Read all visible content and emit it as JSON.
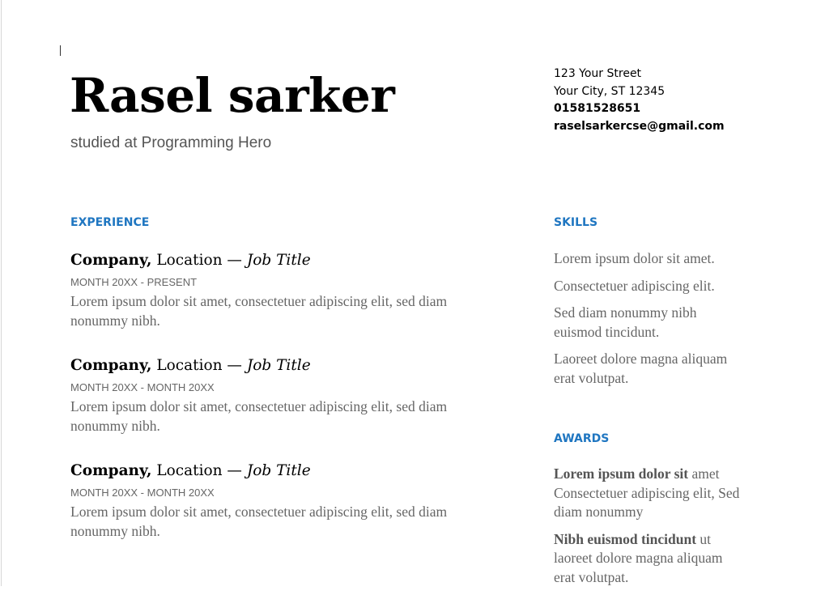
{
  "header": {
    "name": "Rasel sarker",
    "subtitle": "studied at Programming Hero"
  },
  "contact": {
    "street": "123 Your Street",
    "city": "Your City, ST 12345",
    "phone": "01581528651",
    "email": "raselsarkercse@gmail.com"
  },
  "experience": {
    "heading": "EXPERIENCE",
    "separator": " — ",
    "items": [
      {
        "company": "Company,",
        "location": " Location",
        "title": "Job Title",
        "dates": "MONTH 20XX - PRESENT",
        "description": "Lorem ipsum dolor sit amet, consectetuer adipiscing elit, sed diam nonummy nibh."
      },
      {
        "company": "Company,",
        "location": " Location",
        "title": "Job Title",
        "dates": "MONTH 20XX - MONTH 20XX",
        "description": "Lorem ipsum dolor sit amet, consectetuer adipiscing elit, sed diam nonummy nibh."
      },
      {
        "company": "Company,",
        "location": " Location",
        "title": "Job Title",
        "dates": "MONTH 20XX - MONTH 20XX",
        "description": "Lorem ipsum dolor sit amet, consectetuer adipiscing elit, sed diam nonummy nibh."
      }
    ]
  },
  "skills": {
    "heading": "SKILLS",
    "items": [
      "Lorem ipsum dolor sit amet.",
      "Consectetuer adipiscing elit.",
      "Sed diam nonummy nibh euismod tincidunt.",
      "Laoreet dolore magna aliquam erat volutpat."
    ]
  },
  "awards": {
    "heading": "AWARDS",
    "items": [
      {
        "strong": "Lorem ipsum dolor sit",
        "rest": " amet Consectetuer adipiscing elit, Sed diam nonummy"
      },
      {
        "strong": "Nibh euismod tincidunt",
        "rest": " ut laoreet dolore magna aliquam erat volutpat."
      }
    ]
  },
  "colors": {
    "accent": "#1f76c1",
    "body_text": "#666666",
    "heading_text": "#000000"
  }
}
